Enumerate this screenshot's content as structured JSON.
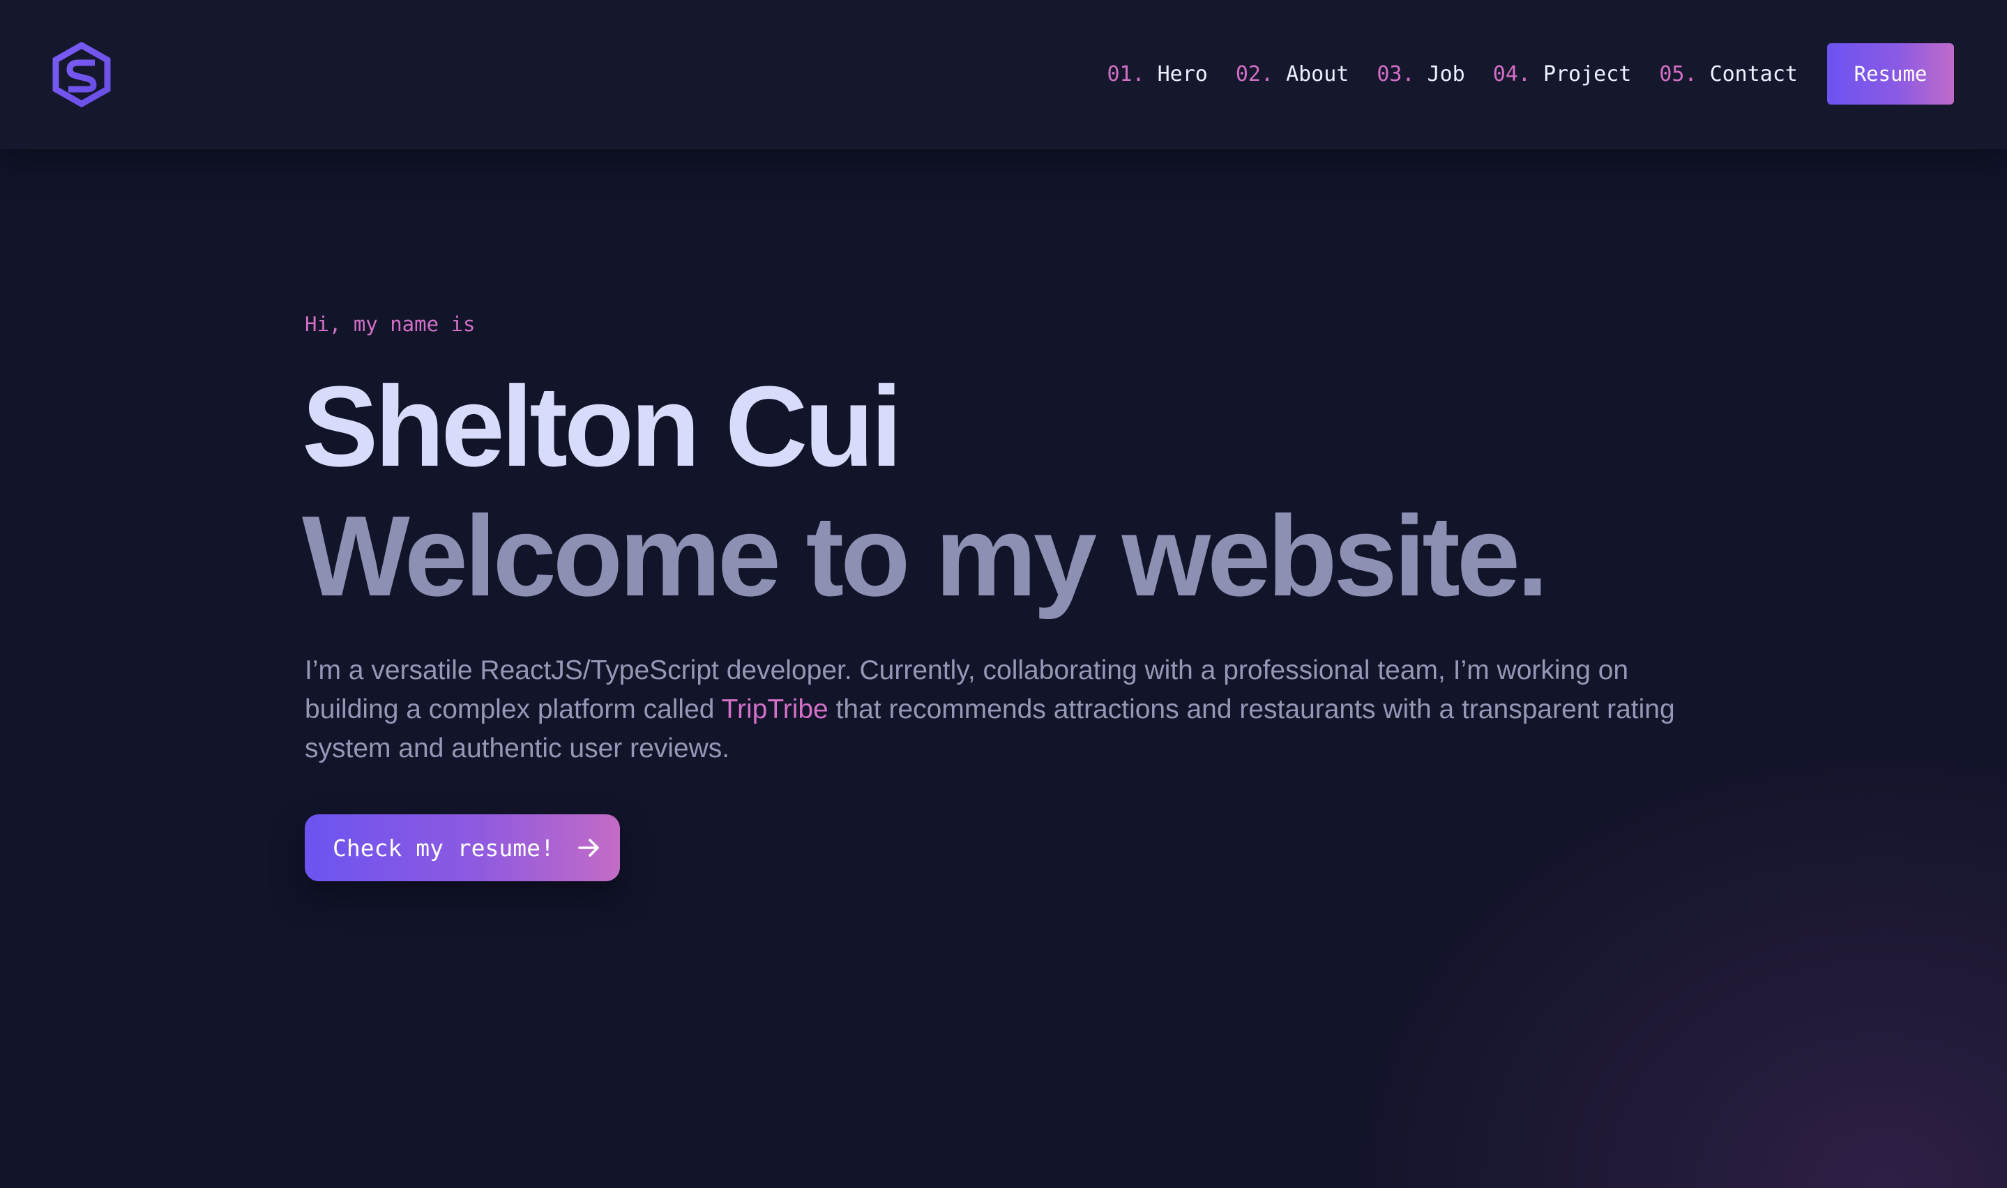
{
  "colors": {
    "background": "#12142a",
    "header": "#15172d",
    "accent_pink": "#d26fc6",
    "accent_purple": "#6c54f0",
    "name_text": "#d9dbfa",
    "tagline_text": "#8e90b3",
    "body_text": "#9597b6"
  },
  "header": {
    "logo_icon": "hexagon-s-logo-icon",
    "nav": [
      {
        "num": "01.",
        "label": "Hero"
      },
      {
        "num": "02.",
        "label": "About"
      },
      {
        "num": "03.",
        "label": "Job"
      },
      {
        "num": "04.",
        "label": "Project"
      },
      {
        "num": "05.",
        "label": "Contact"
      }
    ],
    "resume_label": "Resume"
  },
  "hero": {
    "greeting": "Hi, my name is",
    "name": "Shelton Cui",
    "tagline": "Welcome to my website.",
    "description": {
      "before": "I’m a versatile ReactJS/TypeScript developer. Currently, collaborating with a professional team, I’m working on building a complex platform called ",
      "highlight": "TripTribe",
      "after": " that recommends attractions and restaurants with a transparent rating system and authentic user reviews."
    },
    "cta_label": "Check my resume!",
    "cta_icon": "arrow-right-icon"
  }
}
